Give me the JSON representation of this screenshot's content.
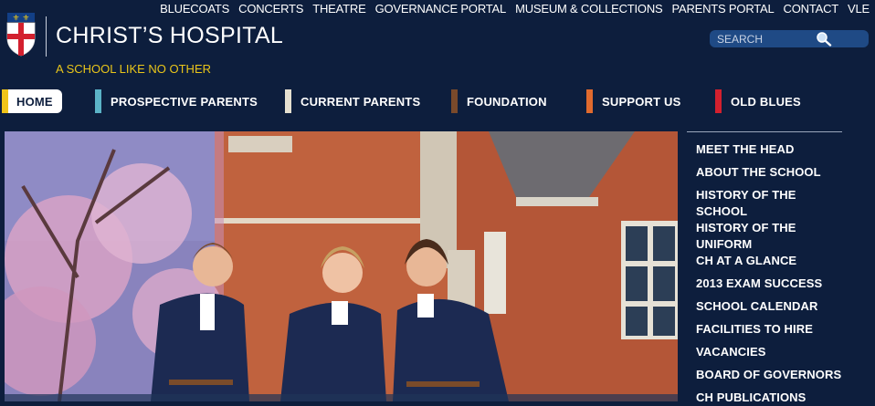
{
  "top_links": [
    "BLUECOATS",
    "CONCERTS",
    "THEATRE",
    "GOVERNANCE PORTAL",
    "MUSEUM & COLLECTIONS",
    "PARENTS PORTAL",
    "CONTACT",
    "VLE"
  ],
  "brand": {
    "name": "CHRIST’S HOSPITAL",
    "tagline": "A SCHOOL LIKE NO OTHER"
  },
  "search": {
    "placeholder": "SEARCH"
  },
  "main_nav": [
    {
      "label": "HOME",
      "color": "#f0c419",
      "active": true
    },
    {
      "label": "PROSPECTIVE PARENTS",
      "color": "#5bb3c7"
    },
    {
      "label": "CURRENT PARENTS",
      "color": "#e5e0d0"
    },
    {
      "label": "FOUNDATION",
      "color": "#7a4a2b"
    },
    {
      "label": "SUPPORT US",
      "color": "#e06a2e"
    },
    {
      "label": "OLD BLUES",
      "color": "#d3202e"
    }
  ],
  "sidebar": [
    "MEET THE HEAD",
    "ABOUT THE SCHOOL",
    "HISTORY OF THE SCHOOL",
    "HISTORY OF THE UNIFORM",
    "CH AT A GLANCE",
    "2013 EXAM SUCCESS",
    "SCHOOL CALENDAR",
    "FACILITIES TO HIRE",
    "VACANCIES",
    "BOARD OF GOVERNORS",
    "CH PUBLICATIONS"
  ],
  "colors": {
    "background": "#0d1e3d",
    "tagline": "#e9c51a",
    "search_bg": "#1f4a85"
  }
}
